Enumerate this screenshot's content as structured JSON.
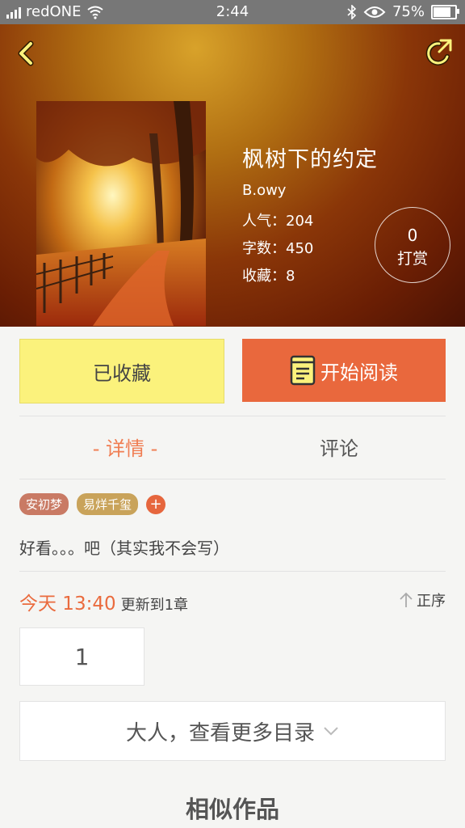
{
  "status_bar": {
    "carrier": "redONE",
    "time": "2:44",
    "battery": "75%",
    "battery_level": 0.75
  },
  "book": {
    "title": "枫树下的约定",
    "author": "B.owy",
    "popularity": "人气：204",
    "word_count": "字数：450",
    "favorites": "收藏：8",
    "tip_count": "0",
    "tip_label": "打赏"
  },
  "actions": {
    "favorite_label": "已收藏",
    "read_label": "开始阅读"
  },
  "tabs": {
    "detail": "- 详情 -",
    "comment": "评论"
  },
  "tags": [
    "安初梦",
    "易烊千玺"
  ],
  "tag_add": "+",
  "description": "好看。。。吧（其实我不会写）",
  "update": {
    "time": "今天 13:40",
    "text": "更新到1章",
    "order_label": "正序"
  },
  "chapter_number": "1",
  "more_catalog": "大人，查看更多目录",
  "similar_works": "相似作品",
  "colors": {
    "accent": "#e9683d",
    "favorite_bg": "#fbf27c",
    "tab_active": "#f07d52"
  }
}
